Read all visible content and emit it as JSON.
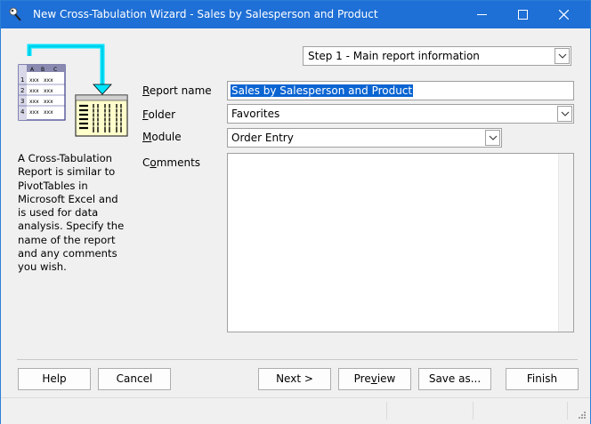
{
  "window": {
    "title": "New Cross-Tabulation Wizard - Sales by Salesperson and Product",
    "controls": [
      "minimize",
      "maximize",
      "close"
    ]
  },
  "step": {
    "selected": "Step 1 - Main report information"
  },
  "illustration": {
    "sheet_headers": [
      "A",
      "B",
      "C"
    ],
    "sheet_rows": [
      "1",
      "2",
      "3",
      "4"
    ],
    "cell_text": "xxx"
  },
  "help_text": "A Cross-Tabulation Report is similar to PivotTables in Microsoft Excel and is used for data analysis. Specify the name of the report and any comments you wish.",
  "form": {
    "report_name": {
      "label_key": "R",
      "label_rest": "eport name",
      "value": "Sales by Salesperson and Product"
    },
    "folder": {
      "label_key": "F",
      "label_rest": "older",
      "value": "Favorites"
    },
    "module": {
      "label_key": "M",
      "label_rest": "odule",
      "value": "Order Entry"
    },
    "comments": {
      "label_pre": "C",
      "label_key": "o",
      "label_rest": "mments",
      "value": ""
    }
  },
  "buttons": {
    "help": "Help",
    "cancel": "Cancel",
    "next": "Next >",
    "preview_pre": "Pre",
    "preview_key": "v",
    "preview_post": "iew",
    "save_as": "Save as...",
    "finish": "Finish"
  },
  "colors": {
    "titlebar": "#1e6fd6",
    "selection": "#0a64d2",
    "arrow": "#00e5ff"
  }
}
